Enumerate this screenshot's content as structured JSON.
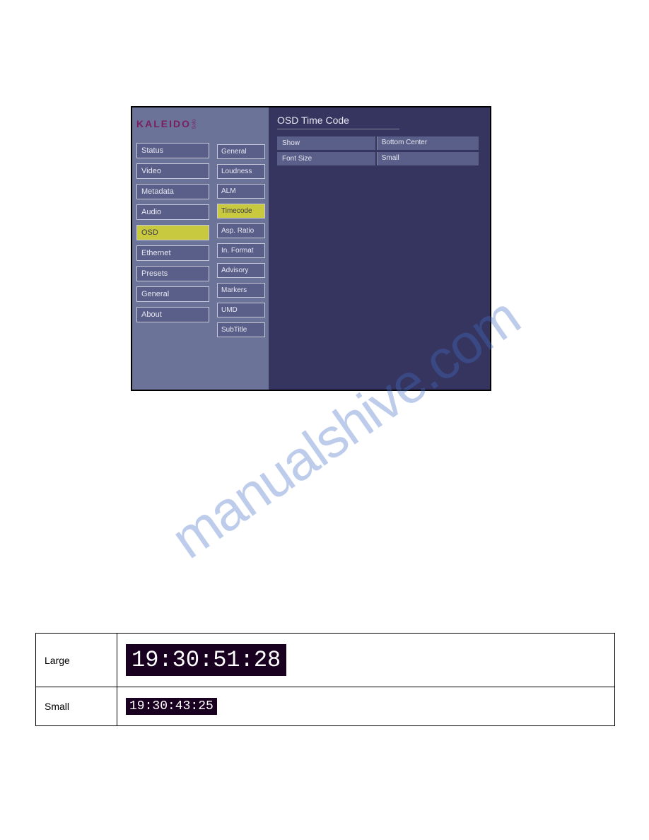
{
  "watermark": "manualshive.com",
  "logo": {
    "main": "KALEIDO",
    "sub": "Solo"
  },
  "sidebar": {
    "items": [
      {
        "label": "Status",
        "active": false
      },
      {
        "label": "Video",
        "active": false
      },
      {
        "label": "Metadata",
        "active": false
      },
      {
        "label": "Audio",
        "active": false
      },
      {
        "label": "OSD",
        "active": true
      },
      {
        "label": "Ethernet",
        "active": false
      },
      {
        "label": "Presets",
        "active": false
      },
      {
        "label": "General",
        "active": false
      },
      {
        "label": "About",
        "active": false
      }
    ]
  },
  "submenu": {
    "items": [
      {
        "label": "General",
        "active": false
      },
      {
        "label": "Loudness",
        "active": false
      },
      {
        "label": "ALM",
        "active": false
      },
      {
        "label": "Timecode",
        "active": true
      },
      {
        "label": "Asp. Ratio",
        "active": false
      },
      {
        "label": "In. Format",
        "active": false
      },
      {
        "label": "Advisory",
        "active": false
      },
      {
        "label": "Markers",
        "active": false
      },
      {
        "label": "UMD",
        "active": false
      },
      {
        "label": "SubTitle",
        "active": false
      }
    ]
  },
  "content": {
    "title": "OSD Time Code",
    "settings": [
      {
        "label": "Show",
        "value": "Bottom Center"
      },
      {
        "label": "Font Size",
        "value": "Small"
      }
    ]
  },
  "examples": [
    {
      "label": "Large",
      "timecode": "19:30:51:28"
    },
    {
      "label": "Small",
      "timecode": "19:30:43:25"
    }
  ]
}
